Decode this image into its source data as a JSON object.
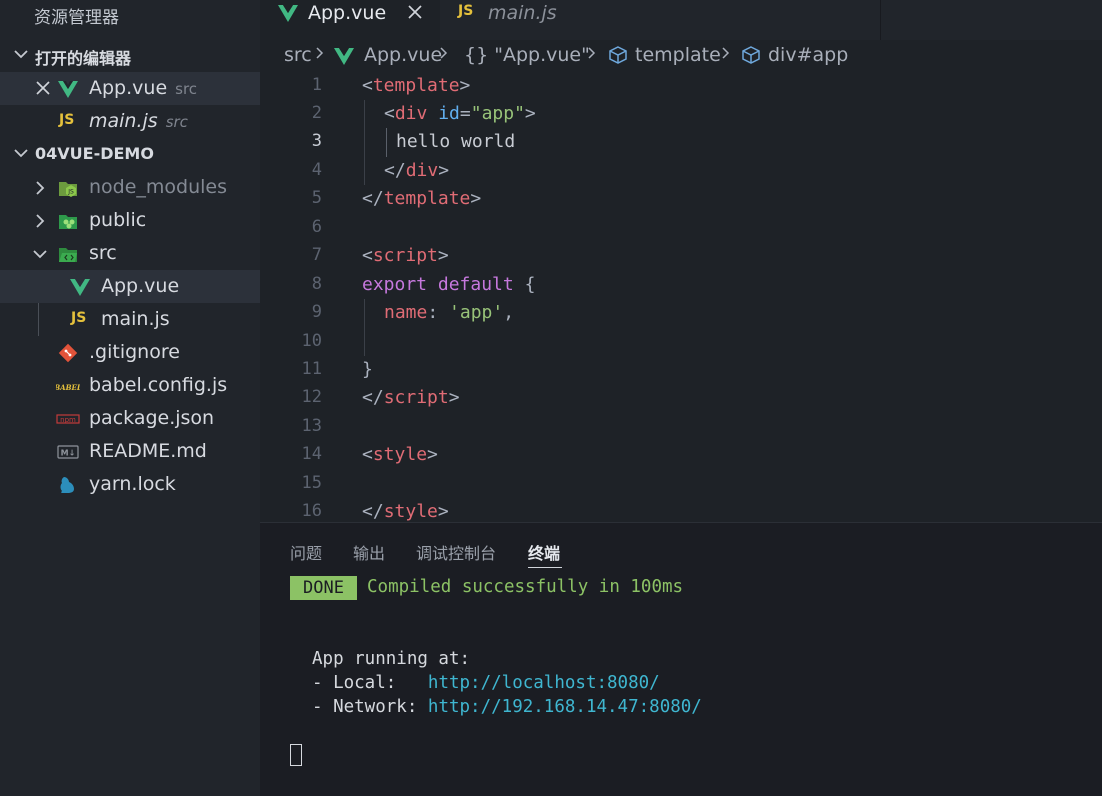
{
  "sidebar": {
    "title": "资源管理器",
    "open_editors": {
      "label": "打开的编辑器",
      "items": [
        {
          "name": "App.vue",
          "folder": "src"
        },
        {
          "name": "main.js",
          "folder": "src"
        }
      ]
    },
    "project": {
      "label": "04VUE-DEMO",
      "items": [
        {
          "name": "node_modules"
        },
        {
          "name": "public"
        },
        {
          "name": "src"
        },
        {
          "name": "App.vue"
        },
        {
          "name": "main.js"
        },
        {
          "name": ".gitignore"
        },
        {
          "name": "babel.config.js"
        },
        {
          "name": "package.json"
        },
        {
          "name": "README.md"
        },
        {
          "name": "yarn.lock"
        }
      ]
    },
    "icon_labels": {
      "js": "JS",
      "node": "JS",
      "babel": "BABEL",
      "npm": "npm",
      "md": "M↓"
    }
  },
  "tabs": [
    {
      "label": "App.vue",
      "active": true
    },
    {
      "label": "main.js",
      "active": false
    }
  ],
  "breadcrumb": [
    "src",
    "App.vue",
    "{} \"App.vue\"",
    "template",
    "div#app"
  ],
  "editor": {
    "line_numbers": [
      "1",
      "2",
      "3",
      "4",
      "5",
      "6",
      "7",
      "8",
      "9",
      "10",
      "11",
      "12",
      "13",
      "14",
      "15",
      "16"
    ],
    "code": {
      "l1_open": "<",
      "l1_tag": "template",
      "l1_close": ">",
      "l2_open": "<",
      "l2_tag": "div",
      "l2_attr": "id",
      "l2_eq": "=",
      "l2_str": "\"app\"",
      "l2_close": ">",
      "l3_text": "hello world",
      "l4_open": "</",
      "l4_tag": "div",
      "l4_close": ">",
      "l5_open": "</",
      "l5_tag": "template",
      "l5_close": ">",
      "l7_open": "<",
      "l7_tag": "script",
      "l7_close": ">",
      "l8_kw1": "export",
      "l8_kw2": "default",
      "l8_brace": " {",
      "l9_prop": "name",
      "l9_colon": ": ",
      "l9_str": "'app'",
      "l9_comma": ",",
      "l11_brace": "}",
      "l12_open": "</",
      "l12_tag": "script",
      "l12_close": ">",
      "l14_open": "<",
      "l14_tag": "style",
      "l14_close": ">",
      "l16_open": "</",
      "l16_tag": "style",
      "l16_close": ">"
    }
  },
  "panel": {
    "tabs": [
      "问题",
      "输出",
      "调试控制台",
      "终端"
    ],
    "active_tab": "终端",
    "terminal": {
      "badge": "DONE",
      "compiled": "Compiled successfully in 100ms",
      "running": "App running at:",
      "local_label": "- Local:   ",
      "local_url": "http://localhost:8080/",
      "network_label": "- Network: ",
      "network_url": "http://192.168.14.47:8080/"
    }
  },
  "colors": {
    "vue_green": "#41b883",
    "js_yellow": "#e5c13c",
    "sidebar_bg": "#21252b",
    "editor_bg": "#1e2227",
    "panel_bg": "#1b1d23",
    "done_green": "#8cc265",
    "link_cyan": "#3fb6d0"
  }
}
